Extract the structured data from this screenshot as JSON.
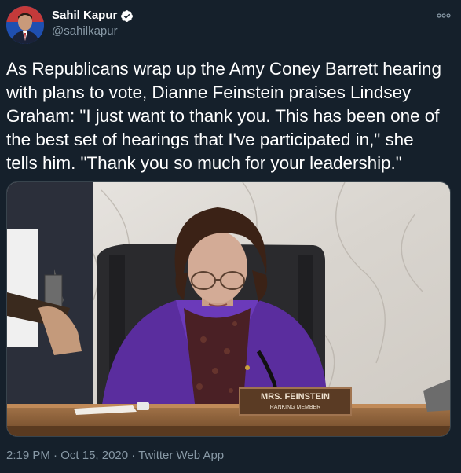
{
  "user": {
    "display_name": "Sahil Kapur",
    "handle": "@sahilkapur",
    "verified": true
  },
  "tweet": {
    "text": "As Republicans wrap up the Amy Coney Barrett hearing\nwith plans to vote, Dianne Feinstein praises Lindsey\nGraham: \"I just want to thank you. This has been one of\nthe best set of hearings that I've participated in,\" she\ntells him. \"Thank you so much for your leadership.\"",
    "time": "2:19 PM",
    "separator1": " · ",
    "date": "Oct 15, 2020",
    "separator2": " · ",
    "source": "Twitter Web App"
  },
  "media": {
    "nameplate_line1": "MRS. FEINSTEIN",
    "nameplate_line2": "RANKING MEMBER"
  },
  "icons": {
    "more": "more-horizontal-icon",
    "verified": "verified-badge-icon"
  },
  "colors": {
    "background": "#15202b",
    "text": "#ffffff",
    "secondary_text": "#8899a6",
    "verified": "#1da1f2"
  }
}
